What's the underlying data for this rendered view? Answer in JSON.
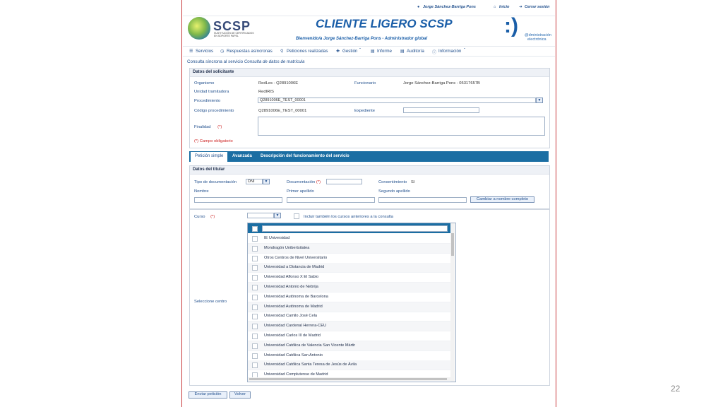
{
  "slide_number": "22",
  "topbar": {
    "user": "Jorge Sánchez-Barriga Pons",
    "home": "Inicio",
    "logout": "Cerrar sesión"
  },
  "brand": {
    "logo_text": "SCSP",
    "logo_subtext": "SUSTITUCIÓN DE CERTIFICADOS EN SOPORTE PAPEL",
    "app_title": "CLIENTE LIGERO SCSP",
    "welcome": "Bienvenido/a Jorge Sánchez-Barriga Pons - Administrador global",
    "smile": ":)",
    "ae_logo_line1": "@dministración",
    "ae_logo_line2": "electrónica"
  },
  "nav": {
    "items": [
      "Servicios",
      "Respuestas asíncronas",
      "Peticiones realizadas",
      "Gestión",
      "Informe",
      "Auditoría",
      "Información"
    ]
  },
  "breadcrumb": {
    "prefix": "Consulta síncrona al servicio",
    "service": "Consulta de datos de matrícula"
  },
  "solicitante": {
    "title": "Datos del solicitante",
    "organismo_label": "Organismo",
    "organismo_value": "RedLes - Q2891006E",
    "funcionario_label": "Funcionario",
    "funcionario_value": "Jorge Sánchez-Barriga Pons - 05317657B",
    "unidad_label": "Unidad tramitadora",
    "unidad_value": "RedIRIS",
    "procedimiento_label": "Procedimiento",
    "procedimiento_value": "Q2891006E_TEST_00001",
    "codigo_label": "Código procedimiento",
    "codigo_value": "Q2891006E_TEST_00001",
    "expediente_label": "Expediente",
    "expediente_value": "",
    "finalidad_label": "Finalidad",
    "required_mark": "(*)",
    "required_note": "(*) Campo obligatorio"
  },
  "tabs": [
    "Petición simple",
    "Avanzada",
    "Descripción del funcionamiento del servicio"
  ],
  "titular": {
    "title": "Datos del titular",
    "tipo_doc_label": "Tipo de documentación",
    "tipo_doc_value": "DNI",
    "documentacion_label": "Documentación",
    "documentacion_value": "",
    "consentimiento_label": "Consentimiento",
    "consentimiento_value": "Sí",
    "nombre_label": "Nombre",
    "primer_apellido_label": "Primer apellido",
    "segundo_apellido_label": "Segundo apellido",
    "cambiar_button": "Cambiar a nombre completo"
  },
  "curso": {
    "label": "Curso",
    "value": "",
    "anteriores_label": "Incluir también los cursos anteriores a la consulta",
    "seleccione_label": "Seleccione centro",
    "centros": [
      "IE Universidad",
      "Mondragón Unibertsitatea",
      "Otros Centros de Nivel Universitario",
      "Universidad a Distancia de Madrid",
      "Universidad Alfonso X El Sabio",
      "Universidad Antonio de Nebrija",
      "Universidad Autónoma de Barcelona",
      "Universidad Autónoma de Madrid",
      "Universidad Camilo José Cela",
      "Universidad Cardenal Herrera-CEU",
      "Universidad Carlos III de Madrid",
      "Universidad Católica de Valencia San Vicente Mártir",
      "Universidad Católica San Antonio",
      "Universidad Católica Santa Teresa de Jesús de Ávila",
      "Universidad Complutense de Madrid"
    ]
  },
  "actions": {
    "send": "Enviar petición",
    "back": "Volver"
  }
}
